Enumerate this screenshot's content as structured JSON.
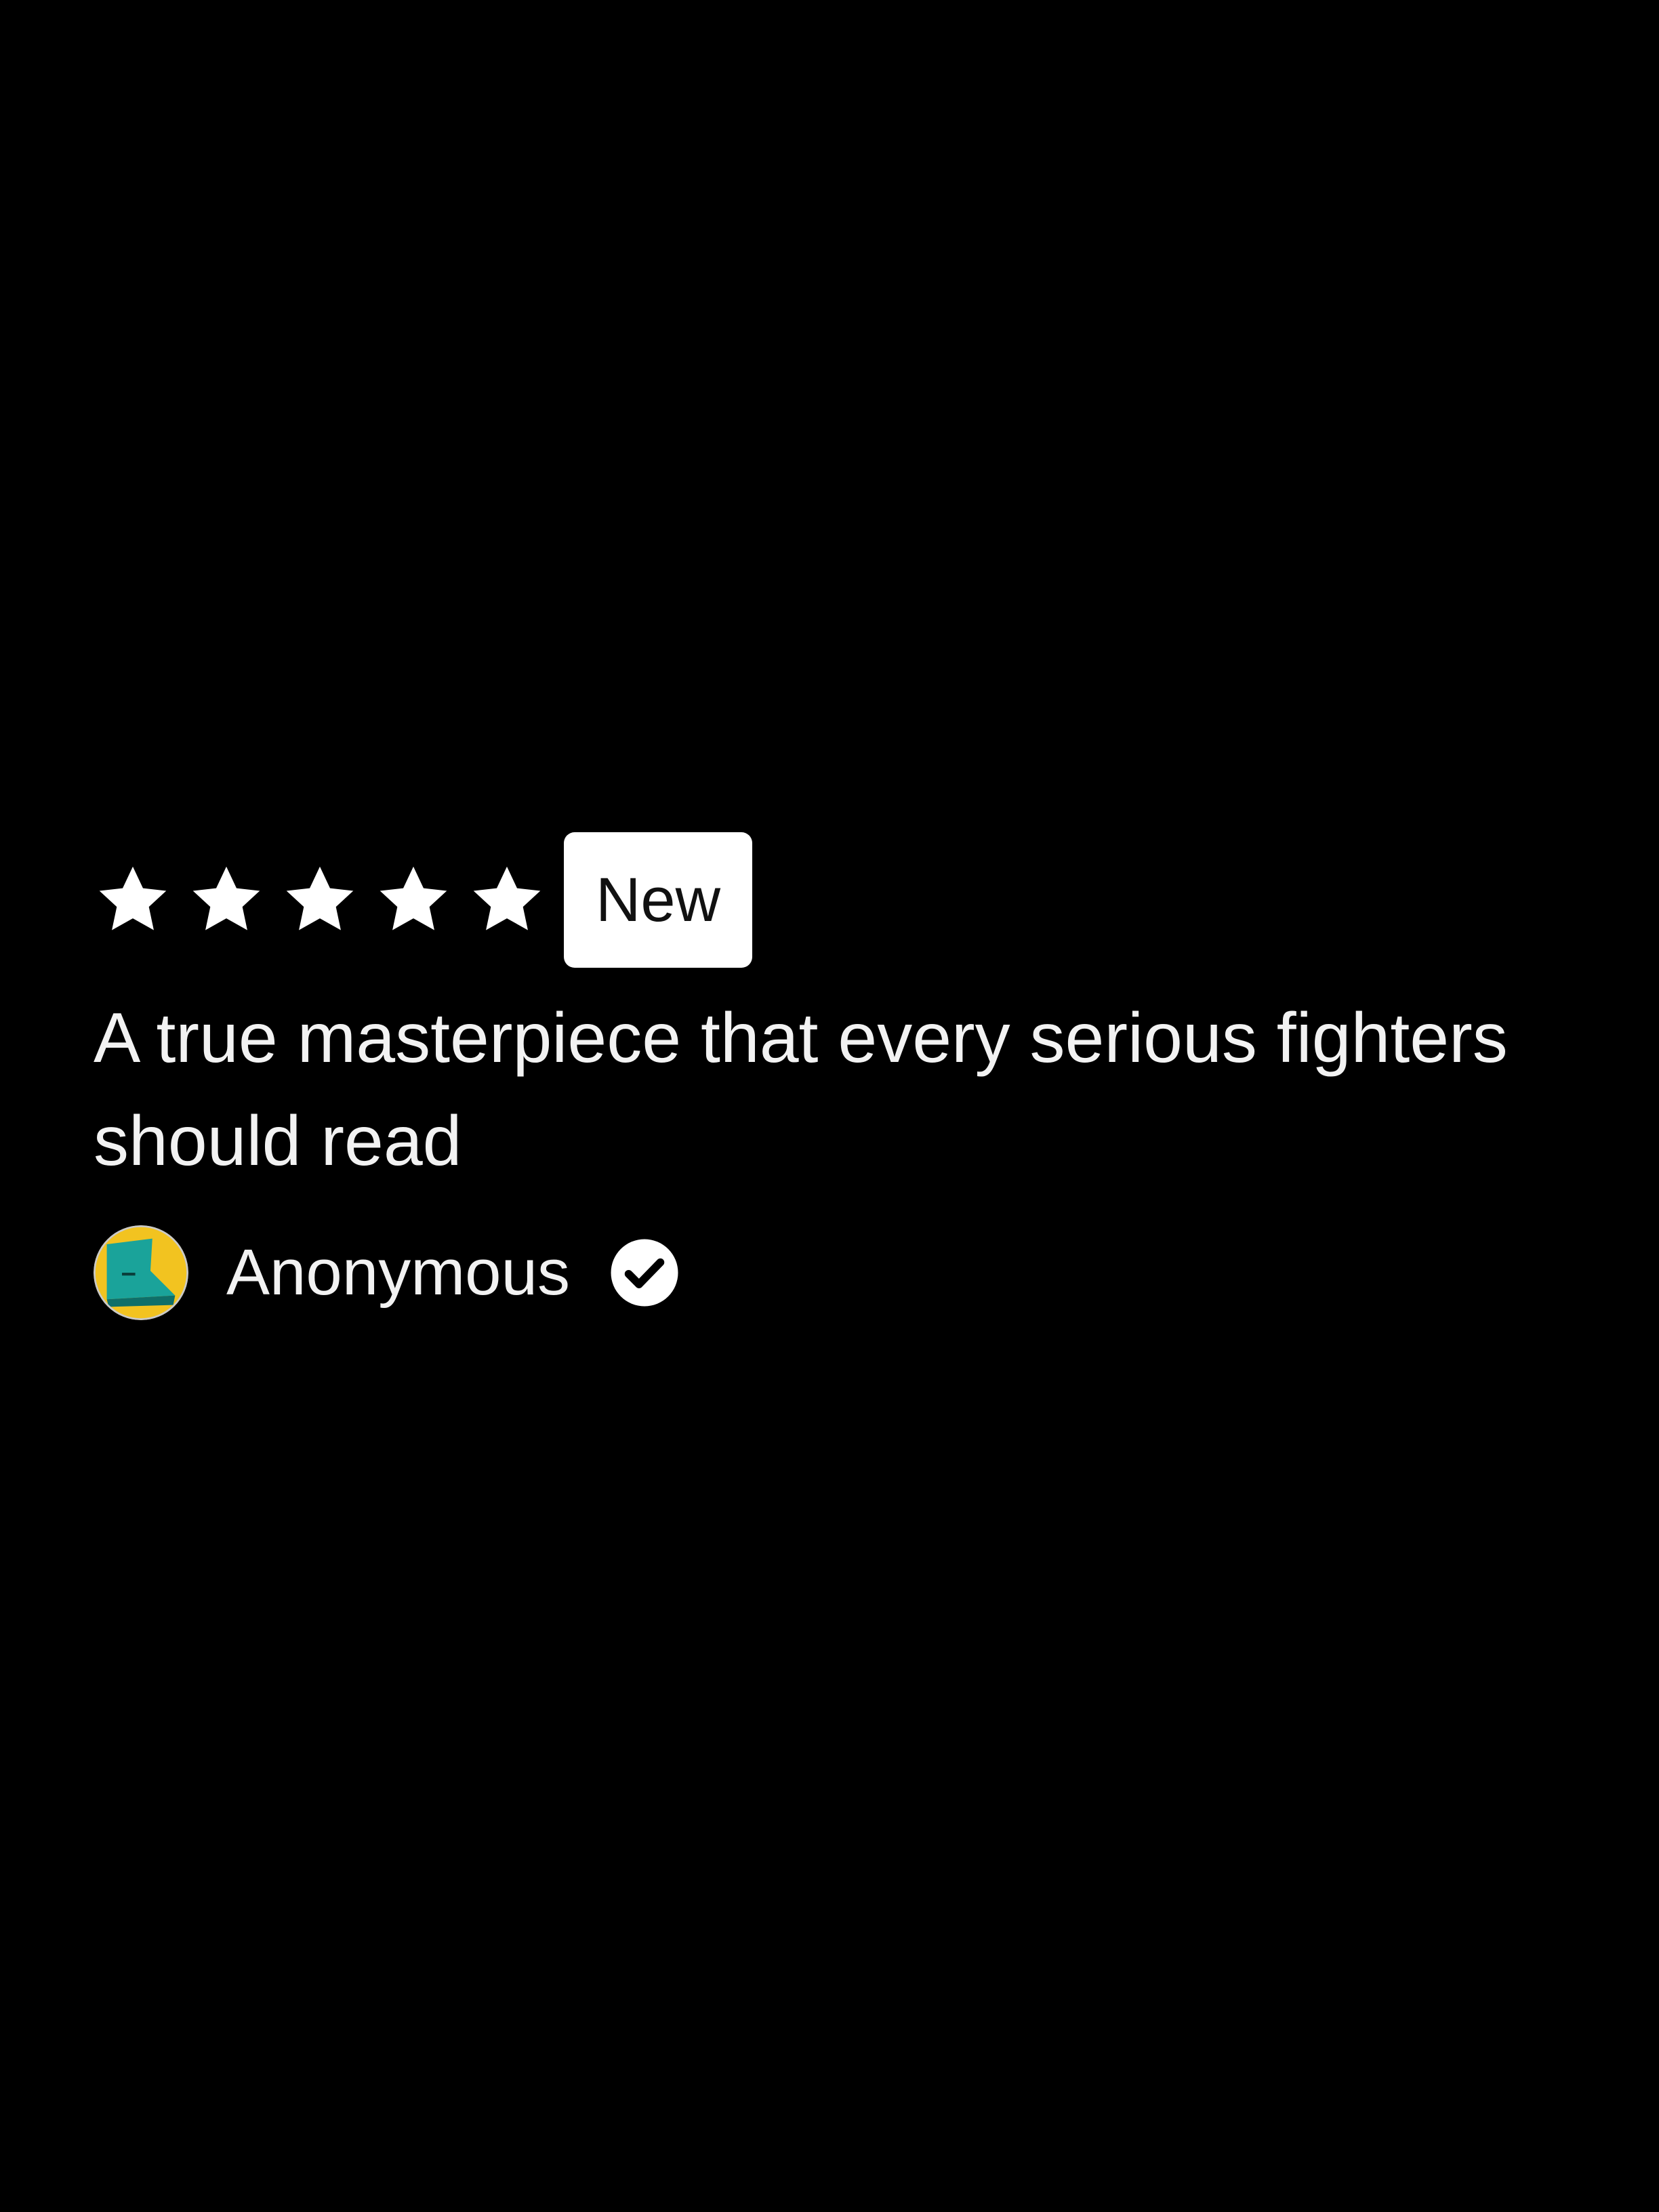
{
  "review": {
    "rating": 5,
    "rating_max": 5,
    "badge": "New",
    "title": "A true masterpiece that every serious fighters should read",
    "author": {
      "name": "Anonymous",
      "verified": true
    }
  },
  "icons": {
    "star": "star-icon",
    "avatar": "avatar-icon",
    "verified": "check-circle-icon"
  },
  "colors": {
    "background": "#000000",
    "text": "#f2f2f2",
    "badge_bg": "#ffffff",
    "badge_text": "#111111",
    "avatar_teal": "#1aa39a",
    "avatar_yellow": "#f2c320"
  }
}
